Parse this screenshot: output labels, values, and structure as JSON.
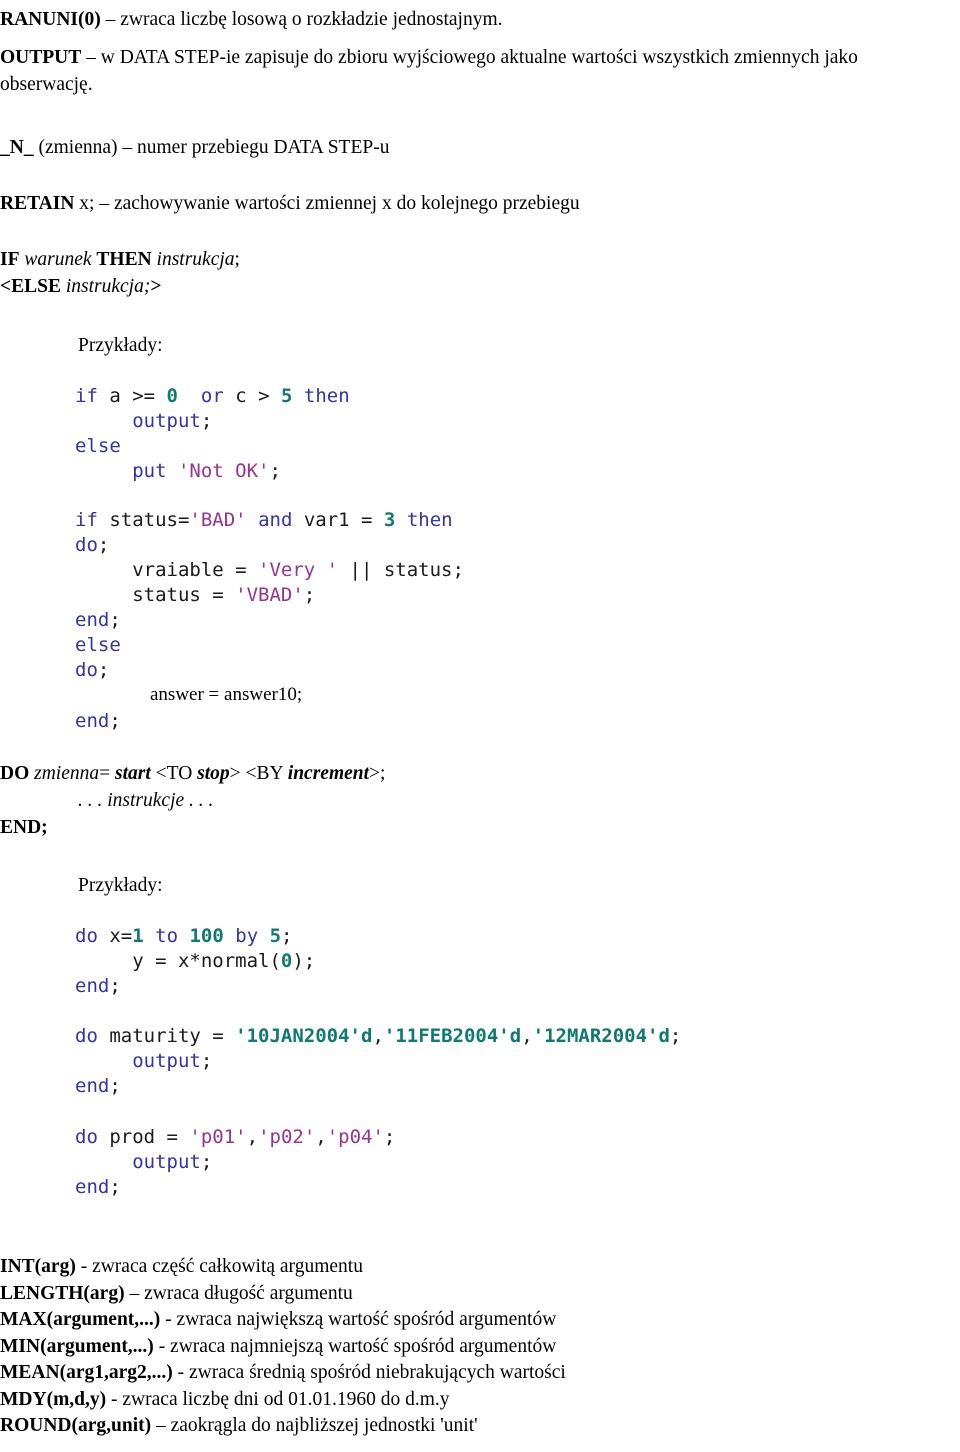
{
  "document": {
    "language": "pl",
    "colors": {
      "keyword": "#3333aa",
      "number": "#0f7a70",
      "string": "#99338f",
      "identifier": "#1a1a1a",
      "text": "#000000",
      "background": "#ffffff"
    }
  },
  "entries": {
    "ranuni": {
      "name": "RANUNI(0)",
      "desc": " – zwraca liczbę losową o rozkładzie jednostajnym."
    },
    "output": {
      "name": "OUTPUT",
      "desc": " – w DATA STEP-ie zapisuje do zbioru wyjściowego aktualne wartości wszystkich zmiennych jako obserwację."
    },
    "n_var": {
      "name": "_N_",
      "arg": " (zmienna)",
      "desc": "  – numer przebiegu DATA STEP-u"
    },
    "retain": {
      "name": "RETAIN",
      "arg": " x;",
      "desc": " – zachowywanie wartości zmiennej x do kolejnego przebiegu"
    }
  },
  "if_statement": {
    "line1_kw1": "IF",
    "line1_it1": " warunek ",
    "line1_kw2": "THEN",
    "line1_it2": " instrukcja",
    "line1_end": ";",
    "line2_pre": "<ELSE",
    "line2_it": " instrukcja;",
    "line2_end": ">",
    "examples_label": "Przykłady:"
  },
  "do_statement": {
    "kw_do": "DO",
    "var": " zmienna",
    "eq": "= ",
    "start": "start",
    "to_open": " <TO ",
    "stop": "stop",
    "to_close": "> ",
    "by_open": "<BY ",
    "increment": "increment",
    "by_close": ">",
    "semi": ";",
    "instructions": ". . . instrukcje . . .",
    "kw_end": "END;",
    "examples_label": "Przykłady:"
  },
  "code_blocks": {
    "if_else_simple": [
      [
        {
          "t": "if",
          "c": "kw"
        },
        {
          "t": " a >= ",
          "c": "id"
        },
        {
          "t": "0",
          "c": "num"
        },
        {
          "t": "  ",
          "c": "id"
        },
        {
          "t": "or",
          "c": "kw"
        },
        {
          "t": " c > ",
          "c": "id"
        },
        {
          "t": "5",
          "c": "num"
        },
        {
          "t": " ",
          "c": "id"
        },
        {
          "t": "then",
          "c": "kw"
        }
      ],
      [
        {
          "t": "     ",
          "c": "id"
        },
        {
          "t": "output",
          "c": "kw"
        },
        {
          "t": ";",
          "c": "id"
        }
      ],
      [
        {
          "t": "else",
          "c": "kw"
        }
      ],
      [
        {
          "t": "     ",
          "c": "id"
        },
        {
          "t": "put",
          "c": "kw"
        },
        {
          "t": " ",
          "c": "id"
        },
        {
          "t": "'Not OK'",
          "c": "str"
        },
        {
          "t": ";",
          "c": "id"
        }
      ]
    ],
    "if_else_do": [
      [
        {
          "t": "if",
          "c": "kw"
        },
        {
          "t": " status=",
          "c": "id"
        },
        {
          "t": "'BAD'",
          "c": "str"
        },
        {
          "t": " ",
          "c": "id"
        },
        {
          "t": "and",
          "c": "kw"
        },
        {
          "t": " var1 = ",
          "c": "id"
        },
        {
          "t": "3",
          "c": "num"
        },
        {
          "t": " ",
          "c": "id"
        },
        {
          "t": "then",
          "c": "kw"
        }
      ],
      [
        {
          "t": "do",
          "c": "kw"
        },
        {
          "t": ";",
          "c": "id"
        }
      ],
      [
        {
          "t": "     vraiable = ",
          "c": "id"
        },
        {
          "t": "'Very '",
          "c": "str"
        },
        {
          "t": " || status;",
          "c": "id"
        }
      ],
      [
        {
          "t": "     status = ",
          "c": "id"
        },
        {
          "t": "'VBAD'",
          "c": "str"
        },
        {
          "t": ";",
          "c": "id"
        }
      ],
      [
        {
          "t": "end",
          "c": "kw"
        },
        {
          "t": ";",
          "c": "id"
        }
      ],
      [
        {
          "t": "else",
          "c": "kw"
        }
      ],
      [
        {
          "t": "do",
          "c": "kw"
        },
        {
          "t": ";",
          "c": "id"
        }
      ]
    ],
    "if_else_do_serif_line": "answer = answer10;",
    "if_else_do_tail": [
      [
        {
          "t": "end",
          "c": "kw"
        },
        {
          "t": ";",
          "c": "id"
        }
      ]
    ],
    "do_loop_numeric": [
      [
        {
          "t": "do",
          "c": "kw"
        },
        {
          "t": " x=",
          "c": "id"
        },
        {
          "t": "1",
          "c": "num"
        },
        {
          "t": " ",
          "c": "id"
        },
        {
          "t": "to",
          "c": "kw"
        },
        {
          "t": " ",
          "c": "id"
        },
        {
          "t": "100",
          "c": "num"
        },
        {
          "t": " ",
          "c": "id"
        },
        {
          "t": "by",
          "c": "kw"
        },
        {
          "t": " ",
          "c": "id"
        },
        {
          "t": "5",
          "c": "num"
        },
        {
          "t": ";",
          "c": "id"
        }
      ],
      [
        {
          "t": "     y = x*normal(",
          "c": "id"
        },
        {
          "t": "0",
          "c": "num"
        },
        {
          "t": ");",
          "c": "id"
        }
      ],
      [
        {
          "t": "end",
          "c": "kw"
        },
        {
          "t": ";",
          "c": "id"
        }
      ]
    ],
    "do_loop_dates": [
      [
        {
          "t": "do",
          "c": "kw"
        },
        {
          "t": " maturity = ",
          "c": "id"
        },
        {
          "t": "'10JAN2004'd",
          "c": "num"
        },
        {
          "t": ",",
          "c": "id"
        },
        {
          "t": "'11FEB2004'd",
          "c": "num"
        },
        {
          "t": ",",
          "c": "id"
        },
        {
          "t": "'12MAR2004'd",
          "c": "num"
        },
        {
          "t": ";",
          "c": "id"
        }
      ],
      [
        {
          "t": "     ",
          "c": "id"
        },
        {
          "t": "output",
          "c": "kw"
        },
        {
          "t": ";",
          "c": "id"
        }
      ],
      [
        {
          "t": "end",
          "c": "kw"
        },
        {
          "t": ";",
          "c": "id"
        }
      ]
    ],
    "do_loop_strings": [
      [
        {
          "t": "do",
          "c": "kw"
        },
        {
          "t": " prod = ",
          "c": "id"
        },
        {
          "t": "'p01'",
          "c": "str"
        },
        {
          "t": ",",
          "c": "id"
        },
        {
          "t": "'p02'",
          "c": "str"
        },
        {
          "t": ",",
          "c": "id"
        },
        {
          "t": "'p04'",
          "c": "str"
        },
        {
          "t": ";",
          "c": "id"
        }
      ],
      [
        {
          "t": "     ",
          "c": "id"
        },
        {
          "t": "output",
          "c": "kw"
        },
        {
          "t": ";",
          "c": "id"
        }
      ],
      [
        {
          "t": "end",
          "c": "kw"
        },
        {
          "t": ";",
          "c": "id"
        }
      ]
    ]
  },
  "functions": [
    {
      "name": "INT(arg)",
      "desc": " - zwraca część całkowitą argumentu"
    },
    {
      "name": "LENGTH(arg)",
      "desc": " – zwraca długość argumentu"
    },
    {
      "name": "MAX(argument,...)",
      "desc": " - zwraca  największą wartość spośród argumentów"
    },
    {
      "name": "MIN(argument,...)",
      "desc": " - zwraca najmniejszą wartość spośród argumentów"
    },
    {
      "name": "MEAN(arg1,arg2,...)",
      "desc": " - zwraca średnią spośród niebrakujących wartości"
    },
    {
      "name": "MDY(m,d,y)",
      "desc": " -  zwraca liczbę dni od 01.01.1960 do d.m.y"
    },
    {
      "name": "ROUND(arg,unit)",
      "desc": " – zaokrągla do najbliższej jednostki 'unit'"
    }
  ]
}
